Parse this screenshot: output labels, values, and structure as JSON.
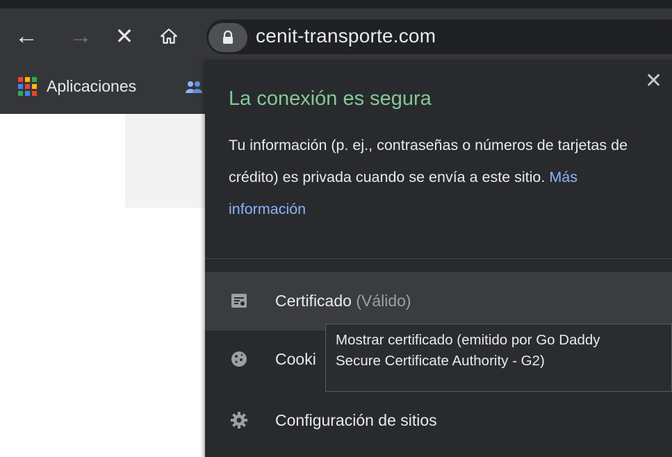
{
  "browser": {
    "url": "cenit-transporte.com",
    "nav": {
      "back_glyph": "←",
      "forward_glyph": "→",
      "stop_glyph": "✕",
      "home_glyph": "⌂"
    }
  },
  "bookmarks": {
    "apps_label": "Aplicaciones",
    "apps_icon": "apps-grid-icon",
    "second_icon": "people-icon"
  },
  "popup": {
    "title": "La conexión es segura",
    "description": "Tu información (p. ej., contraseñas o números de tarjetas de crédito) es privada cuando se envía a este sitio.",
    "more_info_link": "Más información",
    "close_glyph": "✕",
    "rows": [
      {
        "label": "Certificado",
        "status": "(Válido)",
        "icon": "certificate-icon"
      },
      {
        "label": "Cooki",
        "icon": "cookie-icon"
      },
      {
        "label": "Configuración de sitios",
        "icon": "gear-icon"
      }
    ]
  },
  "tooltip": {
    "line1": "Mostrar certificado (emitido por Go Daddy",
    "line2": "Secure Certificate Authority - G2)"
  },
  "colors": {
    "secure_green": "#81c995",
    "link_blue": "#8ab4f8",
    "chrome_bg": "#35363a",
    "popup_bg": "#292a2d"
  }
}
